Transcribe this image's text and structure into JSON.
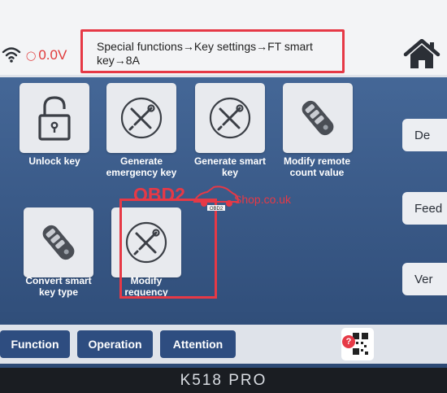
{
  "status": {
    "voltage": "0.0V"
  },
  "breadcrumb": "Special functions→Key settings→FT smart key→8A",
  "functions": [
    {
      "label": "Unlock key",
      "icon": "padlock-icon"
    },
    {
      "label": "Generate emergency key",
      "icon": "tools-icon"
    },
    {
      "label": "Generate smart key",
      "icon": "tools-icon"
    },
    {
      "label": "Modify remote count value",
      "icon": "car-key-fob-icon"
    },
    {
      "label": "Convert smart key type",
      "icon": "car-key-fob-icon"
    },
    {
      "label": "Modify requency",
      "icon": "tools-icon"
    }
  ],
  "side_buttons": [
    {
      "label": "De"
    },
    {
      "label": "Feed"
    },
    {
      "label": "Ver"
    }
  ],
  "tabs": [
    {
      "label": "Function"
    },
    {
      "label": "Operation"
    },
    {
      "label": "Attention"
    }
  ],
  "watermark": {
    "left": "OBD2",
    "right": "Shop.co.uk",
    "badge": "OBD2"
  },
  "device": {
    "model": "K518 PRO"
  },
  "colors": {
    "accent": "#2e4d80",
    "highlight": "#e63946",
    "voltage": "#e03a3a"
  }
}
